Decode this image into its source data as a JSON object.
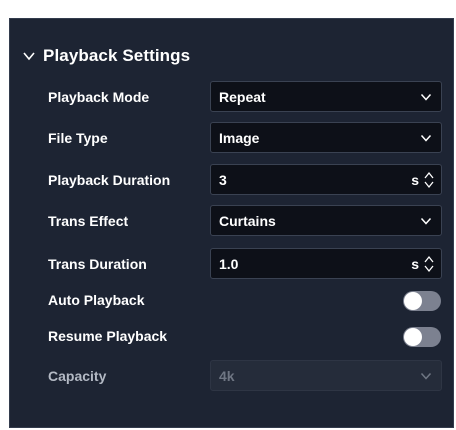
{
  "panel": {
    "title": "Playback Settings"
  },
  "fields": {
    "playback_mode": {
      "label": "Playback Mode",
      "value": "Repeat"
    },
    "file_type": {
      "label": "File Type",
      "value": "Image"
    },
    "playback_duration": {
      "label": "Playback Duration",
      "value": "3",
      "unit": "s"
    },
    "trans_effect": {
      "label": "Trans Effect",
      "value": "Curtains"
    },
    "trans_duration": {
      "label": "Trans Duration",
      "value": "1.0",
      "unit": "s"
    },
    "auto_playback": {
      "label": "Auto Playback",
      "on": false
    },
    "resume_playback": {
      "label": "Resume Playback",
      "on": false
    },
    "capacity": {
      "label": "Capacity",
      "value": "4k",
      "disabled": true
    }
  },
  "icons": {
    "collapse": "chevron-down-icon",
    "dropdown": "chevron-down-icon",
    "stepper": "up-down-spinner-icon"
  },
  "colors": {
    "panel_bg": "#1d2433",
    "input_bg": "#0d1018",
    "toggle_off": "#7c8190",
    "text": "#ffffff"
  }
}
